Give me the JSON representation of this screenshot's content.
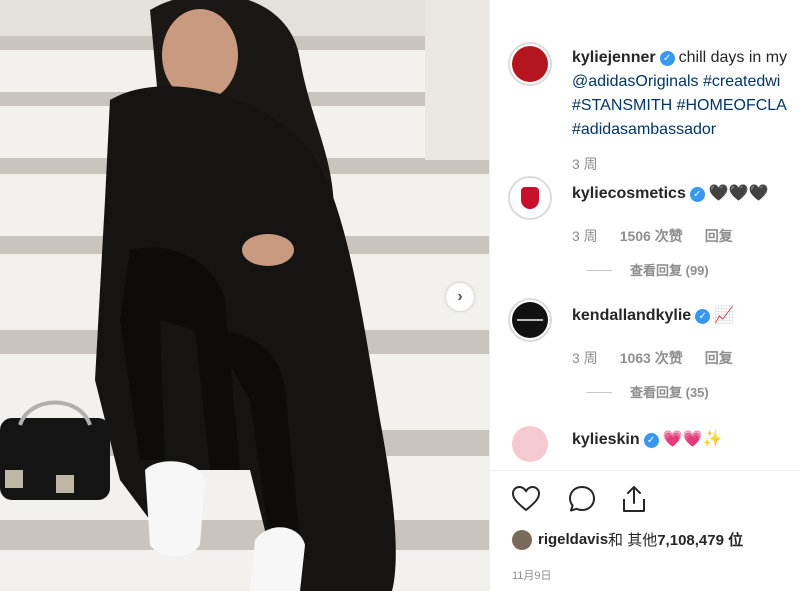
{
  "post": {
    "author": "kyliejenner",
    "caption_lines": [
      "chill days in my",
      "@adidasOriginals #createdwi",
      "#STANSMITH #HOMEOFCLA",
      "#adidasambassador"
    ],
    "time": "3 周"
  },
  "comments": [
    {
      "user": "kyliecosmetics",
      "text": "🖤🖤🖤",
      "time": "3 周",
      "likes": "1506 次赞",
      "reply": "回复",
      "view_replies": "查看回复 (99)",
      "avatar_color": "#c8102e"
    },
    {
      "user": "kendallandkylie",
      "text": "📈",
      "time": "3 周",
      "likes": "1063 次赞",
      "reply": "回复",
      "view_replies": "查看回复 (35)",
      "avatar_color": "#111111"
    },
    {
      "user": "kylieskin",
      "text": "💗💗✨",
      "avatar_color": "#f4c9cf"
    }
  ],
  "footer": {
    "liked_by_user": "rigeldavis",
    "liked_by_text": " 和 其他 ",
    "likes_count": "7,108,479 位",
    "date": "11月9日"
  },
  "icons": [
    "heart-icon",
    "comment-icon",
    "share-icon",
    "next-arrow-icon",
    "verified-badge-icon"
  ],
  "colors": {
    "verified": "#3897f0",
    "hashtag": "#003569",
    "meta": "#8e8e8e"
  }
}
